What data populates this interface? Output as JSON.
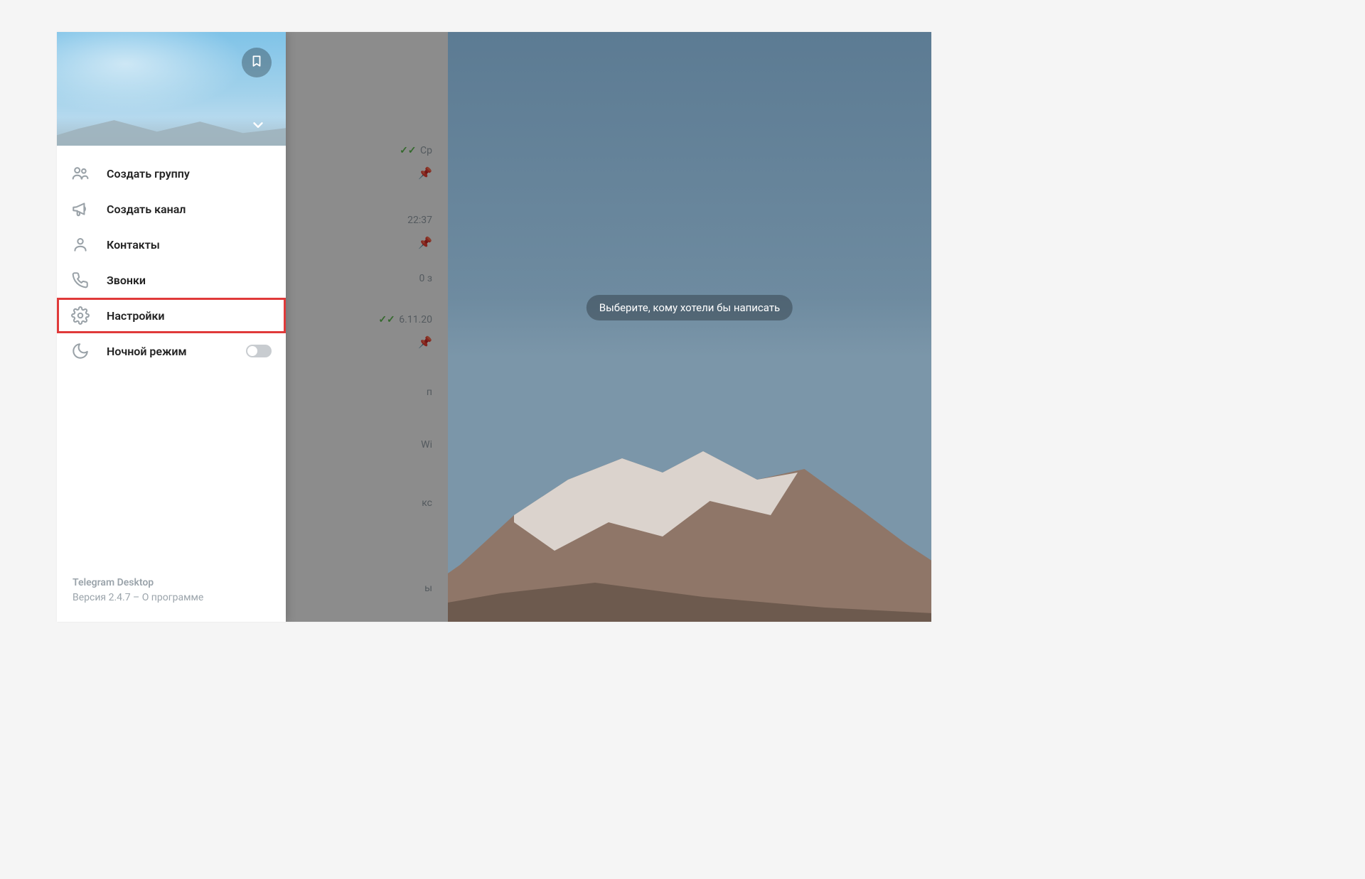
{
  "menu": {
    "items": [
      {
        "icon": "group-icon",
        "label": "Создать группу"
      },
      {
        "icon": "megaphone-icon",
        "label": "Создать канал"
      },
      {
        "icon": "person-icon",
        "label": "Контакты"
      },
      {
        "icon": "phone-icon",
        "label": "Звонки"
      },
      {
        "icon": "gear-icon",
        "label": "Настройки"
      },
      {
        "icon": "moon-icon",
        "label": "Ночной режим"
      }
    ],
    "highlighted_index": 4,
    "night_mode_on": false
  },
  "footer": {
    "app_name": "Telegram Desktop",
    "version_line": "Версия 2.4.7 – О программе"
  },
  "mainpane": {
    "placeholder": "Выберите, кому хотели бы написать"
  },
  "chatlist": {
    "rows": [
      {
        "time": "Ср",
        "ticks": true,
        "pinned": true
      },
      {
        "time": "22:37",
        "ticks": false,
        "pinned": true
      },
      {
        "time": "0 з",
        "ticks": false,
        "pinned": false
      },
      {
        "time": "6.11.20",
        "ticks": true,
        "pinned": true
      },
      {
        "time": "п",
        "ticks": false,
        "pinned": false
      },
      {
        "time": "Wi",
        "ticks": false,
        "pinned": false
      },
      {
        "time": "кс",
        "ticks": false,
        "pinned": false
      },
      {
        "time": "ы",
        "ticks": false,
        "pinned": false
      }
    ]
  }
}
